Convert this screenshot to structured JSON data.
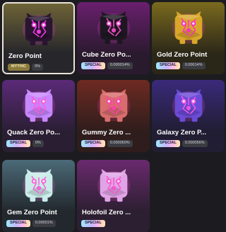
{
  "items": [
    {
      "name": "Zero Point",
      "badge": "MYTHIC",
      "badge_type": "mythic",
      "chance": "0%",
      "selected": true,
      "bg_top": "#6e6437",
      "bg_bottom": "#26262b",
      "body": "#2a1530",
      "glow": "#ff3df0"
    },
    {
      "name": "Cube Zero Po...",
      "badge": "SPECIAL",
      "badge_type": "special",
      "chance": "0.000014%",
      "selected": false,
      "bg_top": "#6a1f6e",
      "bg_bottom": "#2a1a2e",
      "body": "#1d1722",
      "glow": "#ff4fd0"
    },
    {
      "name": "Gold Zero Point",
      "badge": "SPECIAL",
      "badge_type": "special",
      "chance": "0.00014%",
      "selected": false,
      "bg_top": "#7a6a1e",
      "bg_bottom": "#2b2718",
      "body": "#d9a62a",
      "glow": "#ff2ad0"
    },
    {
      "name": "Quack Zero Po...",
      "badge": "SPECIAL",
      "badge_type": "special",
      "chance": "0%",
      "selected": false,
      "bg_top": "#5b2a78",
      "bg_bottom": "#2a1e33",
      "body": "#c788ff",
      "glow": "#ff59d8"
    },
    {
      "name": "Gummy Zero ...",
      "badge": "SPECIAL",
      "badge_type": "special",
      "chance": "0.000069%",
      "selected": false,
      "bg_top": "#6e2a22",
      "bg_bottom": "#2e1d1c",
      "body": "#d86d6d",
      "glow": "#ff3fb0"
    },
    {
      "name": "Galaxy Zero P...",
      "badge": "SPECIAL",
      "badge_type": "special",
      "chance": "0.000056%",
      "selected": false,
      "bg_top": "#3a2a7a",
      "bg_bottom": "#211d33",
      "body": "#6c4bd6",
      "glow": "#ff55e8"
    },
    {
      "name": "Gem Zero Point",
      "badge": "SPECIAL",
      "badge_type": "special",
      "chance": "0.00001%",
      "selected": false,
      "bg_top": "#4b6a78",
      "bg_bottom": "#22282d",
      "body": "#c9ece8",
      "glow": "#ff5ad8"
    },
    {
      "name": "Holofoil Zero ...",
      "badge": "SPECIAL",
      "badge_type": "special",
      "chance": "",
      "selected": false,
      "bg_top": "#6a2a6e",
      "bg_bottom": "#2c1f31",
      "body": "#e0a4e6",
      "glow": "#ff4fd0"
    }
  ]
}
